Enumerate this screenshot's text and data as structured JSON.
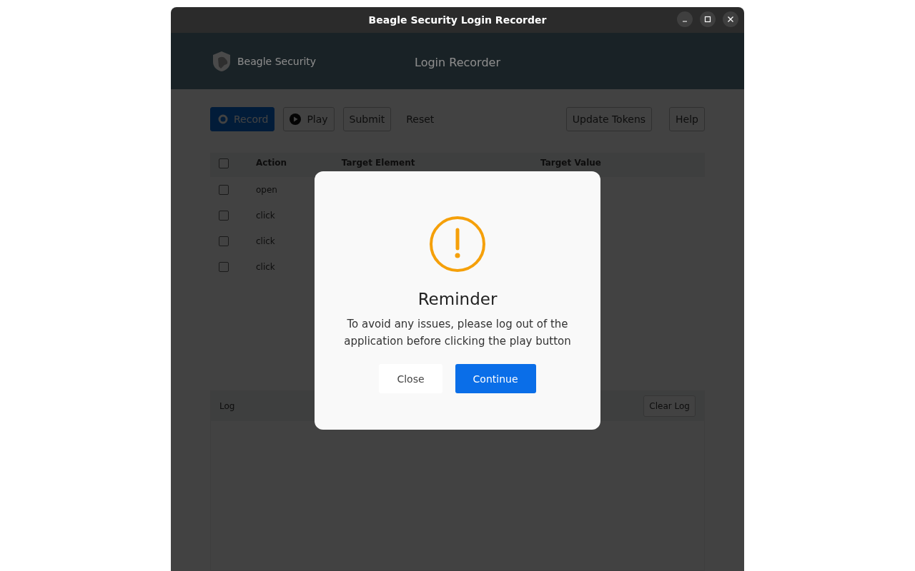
{
  "window": {
    "title": "Beagle Security Login Recorder"
  },
  "header": {
    "brand": "Beagle Security",
    "title": "Login Recorder"
  },
  "toolbar": {
    "left": [
      {
        "label": "Record",
        "kind": "record"
      },
      {
        "label": "Play",
        "kind": "play"
      },
      {
        "label": "Submit",
        "kind": "outlined"
      },
      {
        "label": "Reset",
        "kind": "plain"
      }
    ],
    "right": [
      {
        "label": "Update Tokens"
      },
      {
        "label": "Help"
      }
    ]
  },
  "table": {
    "header_checked": false,
    "columns": [
      "Action",
      "Target Element",
      "Target Value"
    ],
    "rows": [
      {
        "checked": false,
        "action": "open"
      },
      {
        "checked": false,
        "action": "click"
      },
      {
        "checked": false,
        "action": "click"
      },
      {
        "checked": false,
        "action": "click"
      }
    ]
  },
  "log": {
    "title": "Log",
    "clear_button": "Clear Log"
  },
  "dialog": {
    "title": "Reminder",
    "message": "To avoid any issues, please log out of the application before clicking the play button",
    "buttons": [
      {
        "label": "Close",
        "kind": "secondary"
      },
      {
        "label": "Continue",
        "kind": "primary"
      }
    ]
  }
}
